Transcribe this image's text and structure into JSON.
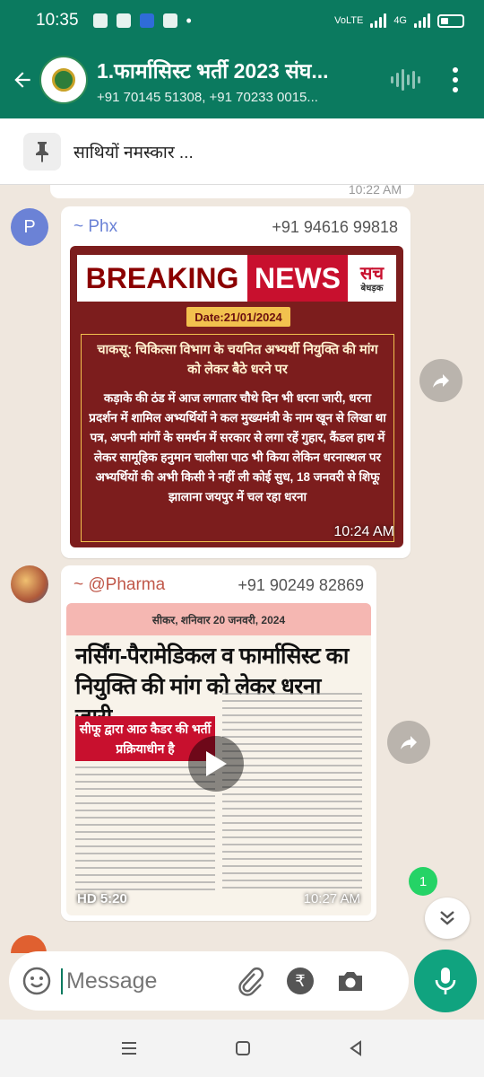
{
  "status_bar": {
    "time": "10:35",
    "network": "VoLTE",
    "network_gen": "4G"
  },
  "header": {
    "title": "1.फार्मासिस्ट भर्ती 2023 संघ...",
    "subtitle": "+91 70145 51308, +91 70233 0015..."
  },
  "pinned": {
    "text": "साथियों नमस्कार ..."
  },
  "messages": [
    {
      "avatar_letter": "P",
      "sender": "~ Phx",
      "phone": "+91 94616 99818",
      "time": "10:24 AM",
      "image": {
        "breaking": "BREAKING",
        "news": "NEWS",
        "logo_main": "सच",
        "logo_sub": "बेधड़क",
        "date": "Date:21/01/2024",
        "headline": "चाकसू: चिकित्सा विभाग के चयनित अभ्यर्थी नियुक्ति की मांग को लेकर बैठे धरने पर",
        "body": "कड़ाके की ठंड में आज लगातार चौथे दिन भी धरना जारी, धरना प्रदर्शन में शामिल अभ्यर्थियों ने कल मुख्यमंत्री के नाम खून से लिखा था पत्र, अपनी मांगों के समर्थन में सरकार से लगा रहें गुहार, कैंडल हाथ में लेकर सामूहिक हनुमान चालीसा पाठ भी किया लेकिन धरनास्थल पर अभ्यर्थियों की अभी किसी ने नहीं ली कोई सुध, 18 जनवरी से शिफू झालाना जयपुर में चल रहा धरना"
      }
    },
    {
      "sender": "~ @Pharma",
      "phone": "+91 90249 82869",
      "time": "10:27 AM",
      "video": {
        "paper_header": "सीकर, शनिवार 20 जनवरी, 2024",
        "headline": "नर्सिंग-पैरामेडिकल व फार्मासिस्ट का नियुक्ति की मांग को लेकर धरना जारी",
        "red_box": "सीफू द्वारा आठ कैडर की भर्ती प्रक्रियाधीन है",
        "hd_label": "HD",
        "duration": "5:20"
      }
    }
  ],
  "unread_count": "1",
  "composer": {
    "placeholder": "Message",
    "rupee_symbol": "₹"
  },
  "colors": {
    "header_bg": "#0b7a5f",
    "mic_bg": "#10a37f",
    "unread_badge": "#25d366",
    "chat_bg": "#efe7de",
    "sender_phx": "#6b82d6",
    "sender_pharma": "#c0584a"
  }
}
